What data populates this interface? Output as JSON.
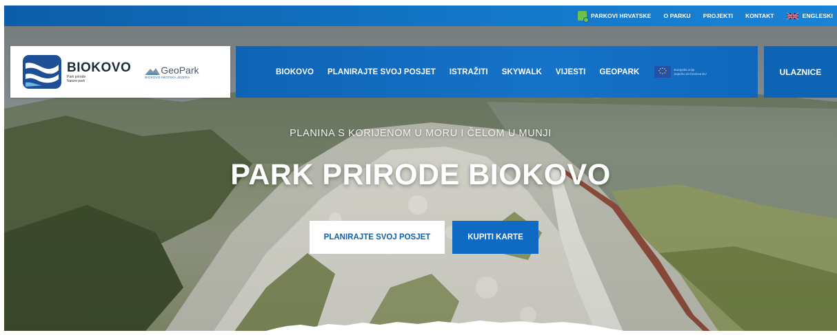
{
  "topbar": {
    "links": [
      {
        "label": "PARKOVI HRVATSKE",
        "icon": "parks-croatia-icon"
      },
      {
        "label": "O PARKU"
      },
      {
        "label": "PROJEKTI"
      },
      {
        "label": "KONTAKT"
      },
      {
        "label": "ENGLESKI",
        "icon": "uk-flag-icon"
      }
    ]
  },
  "logo": {
    "title": "BIOKOVO",
    "sub1": "Park prirode",
    "sub2": "Nature park",
    "geopark_title": "GeoPark",
    "geopark_sub": "BIOKOVO-IMOTSKA JEZERA"
  },
  "nav": {
    "items": [
      "BIOKOVO",
      "PLANIRAJTE SVOJ POSJET",
      "ISTRAŽITI",
      "SKYWALK",
      "VIJESTI",
      "GEOPARK"
    ],
    "eu_line1": "Europska unija",
    "eu_line2": "Zajedno do fondova EU",
    "tickets": "ULAZNICE"
  },
  "hero": {
    "tagline": "PLANINA S KORIJENOM U MORU I ČELOM U MUNJI",
    "headline": "PARK PRIRODE BIOKOVO",
    "btn_plan": "PLANIRAJTE SVOJ POSJET",
    "btn_buy": "KUPITI KARTE"
  },
  "colors": {
    "brand_blue": "#0f63b5",
    "topbar_blue": "#1376c7",
    "parks_green": "#6cc24a"
  }
}
